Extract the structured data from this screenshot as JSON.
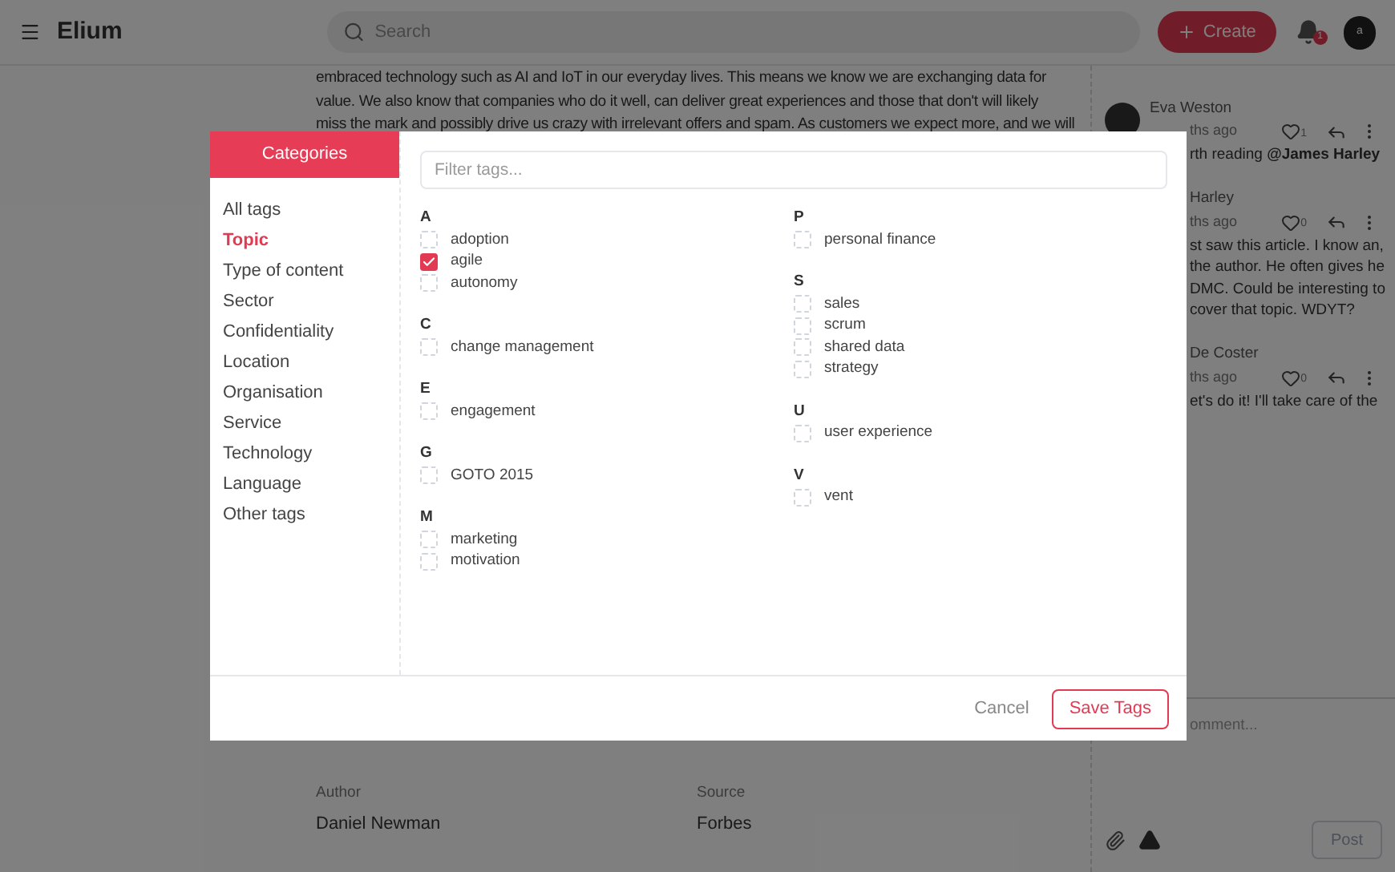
{
  "header": {
    "app_name": "Elium",
    "search": {
      "placeholder": "Search"
    },
    "create_button": "Create",
    "notification_badge": "1",
    "avatar_letter": "a"
  },
  "article": {
    "lines": [
      "embraced technology such as AI and IoT in our everyday lives. This means we know we are exchanging data for",
      "value. We also know that companies who do it well, can deliver great experiences and those that don't will likely",
      "miss the mark and possibly drive us crazy with irrelevant offers and spam. As customers we expect more, and we will"
    ],
    "meta": [
      {
        "label": "Author",
        "value": "Daniel Newman"
      },
      {
        "label": "Source",
        "value": "Forbes"
      }
    ]
  },
  "comments": [
    {
      "author": "Eva Weston",
      "time": "ths ago",
      "likes": "1",
      "text": "rth reading **@James Harley**"
    },
    {
      "author": "Harley",
      "time": "ths ago",
      "likes": "0",
      "text": "st saw this article. I know an, the author. He often gives he DMC. Could be interesting to cover that topic. WDYT?"
    },
    {
      "author": "De Coster",
      "time": "ths ago",
      "likes": "0",
      "text": "et's do it! I'll take care of the"
    }
  ],
  "comment_box": {
    "placeholder": "omment...",
    "post_button": "Post",
    "post_disabled": true
  },
  "modal": {
    "sidebar_title": "Categories",
    "categories": [
      {
        "label": "All tags",
        "selected": false
      },
      {
        "label": "Topic",
        "selected": true
      },
      {
        "label": "Type of content",
        "selected": false
      },
      {
        "label": "Sector",
        "selected": false
      },
      {
        "label": "Confidentiality",
        "selected": false
      },
      {
        "label": "Location",
        "selected": false
      },
      {
        "label": "Organisation",
        "selected": false
      },
      {
        "label": "Service",
        "selected": false
      },
      {
        "label": "Technology",
        "selected": false
      },
      {
        "label": "Language",
        "selected": false
      },
      {
        "label": "Other tags",
        "selected": false
      }
    ],
    "filter": {
      "placeholder": "Filter tags..."
    },
    "tag_columns": [
      [
        {
          "letter": "A",
          "tags": [
            {
              "label": "adoption",
              "checked": false
            },
            {
              "label": "agile",
              "checked": true
            },
            {
              "label": "autonomy",
              "checked": false
            }
          ]
        },
        {
          "letter": "C",
          "tags": [
            {
              "label": "change management",
              "checked": false
            }
          ]
        },
        {
          "letter": "E",
          "tags": [
            {
              "label": "engagement",
              "checked": false
            }
          ]
        },
        {
          "letter": "G",
          "tags": [
            {
              "label": "GOTO 2015",
              "checked": false
            }
          ]
        },
        {
          "letter": "M",
          "tags": [
            {
              "label": "marketing",
              "checked": false
            },
            {
              "label": "motivation",
              "checked": false
            }
          ]
        }
      ],
      [
        {
          "letter": "P",
          "tags": [
            {
              "label": "personal finance",
              "checked": false
            }
          ]
        },
        {
          "letter": "S",
          "tags": [
            {
              "label": "sales",
              "checked": false
            },
            {
              "label": "scrum",
              "checked": false
            },
            {
              "label": "shared data",
              "checked": false
            },
            {
              "label": "strategy",
              "checked": false
            }
          ]
        },
        {
          "letter": "U",
          "tags": [
            {
              "label": "user experience",
              "checked": false
            }
          ]
        },
        {
          "letter": "V",
          "tags": [
            {
              "label": "vent",
              "checked": false
            }
          ]
        }
      ]
    ],
    "cancel_button": "Cancel",
    "save_button": "Save Tags"
  }
}
